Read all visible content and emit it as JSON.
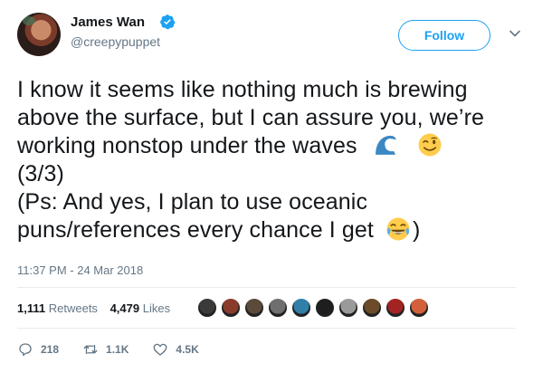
{
  "user": {
    "display_name": "James Wan",
    "handle": "@creepypuppet",
    "verified": true
  },
  "follow_button": {
    "label": "Follow"
  },
  "tweet": {
    "lines": [
      "I know it seems like nothing much is brewing",
      "above the surface, but I can assure you, we’re",
      "working nonstop under the waves",
      "(3/3)",
      "(Ps: And yes, I plan to use oceanic",
      "puns/references every chance I get",
      ")"
    ],
    "emojis": [
      "water-wave-emoji",
      "winking-face-emoji",
      "face-with-tears-of-joy-emoji"
    ]
  },
  "timestamp": "11:37 PM - 24 Mar 2018",
  "stats": {
    "retweets_count": "1,111",
    "retweets_label": "Retweets",
    "likes_count": "4,479",
    "likes_label": "Likes",
    "liker_avatar_colors": [
      "#3b3a38",
      "#8a3c2c",
      "#5b4a3a",
      "#6f6f6f",
      "#2f7fa8",
      "#1e1e1e",
      "#9a9a9a",
      "#6b4b2a",
      "#a32222",
      "#d2603a"
    ]
  },
  "actions": {
    "replies": "218",
    "retweets": "1.1K",
    "likes": "4.5K"
  },
  "colors": {
    "accent": "#1da1f2",
    "secondary_text": "#657786",
    "divider": "#e6ecf0"
  }
}
